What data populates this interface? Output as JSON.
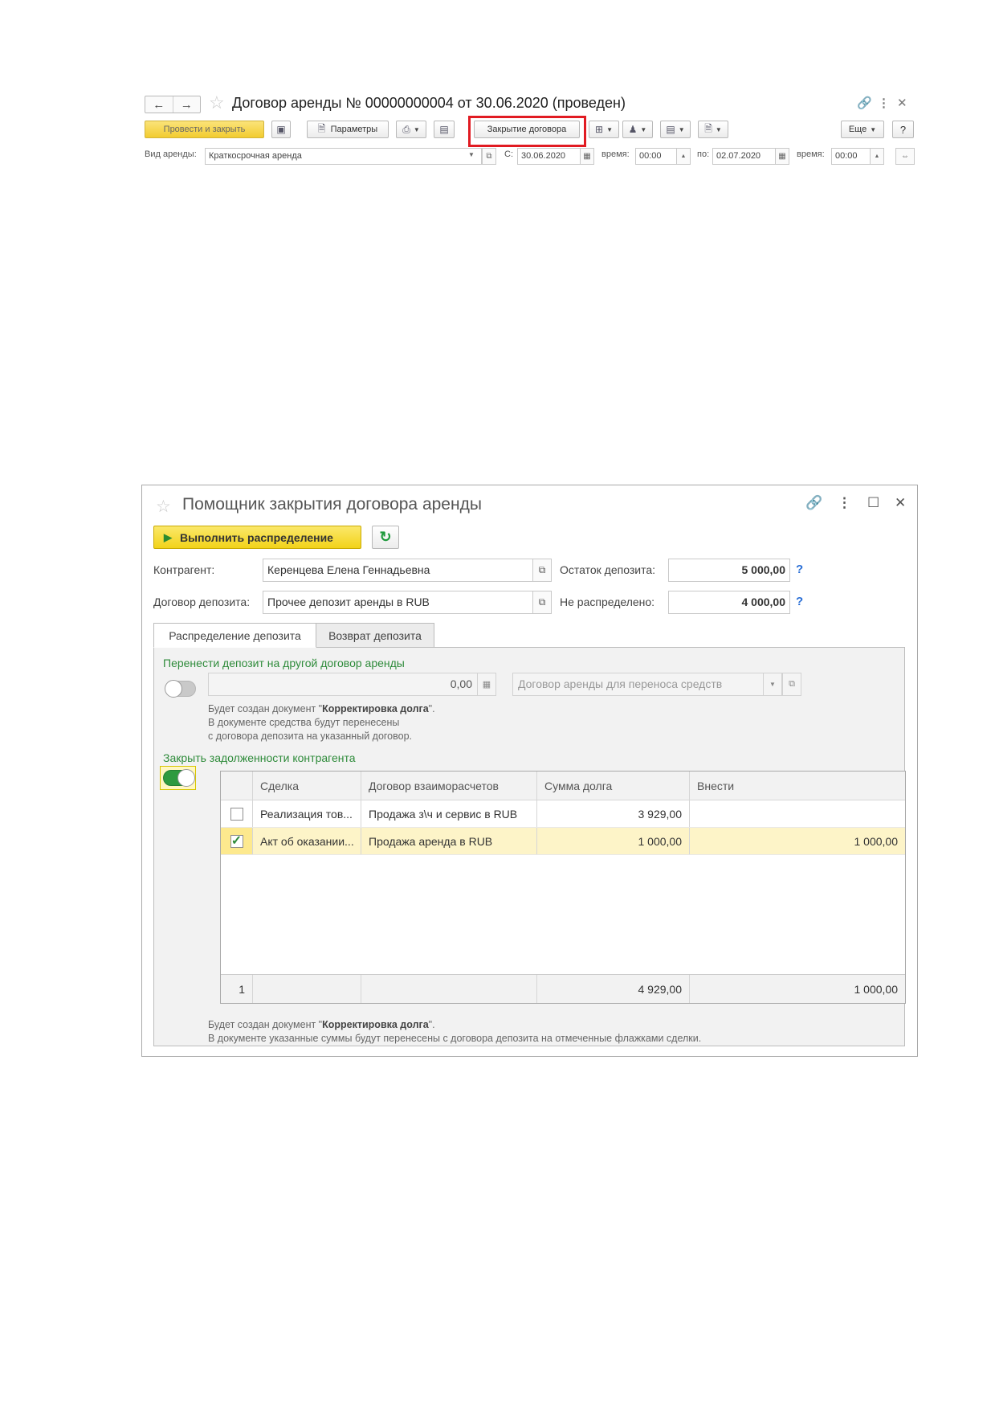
{
  "document": {
    "title": "Договор аренды № 00000000004 от 30.06.2020 (проведен)",
    "toolbar": {
      "post_and_close": "Провести и закрыть",
      "parameters": "Параметры",
      "close_contract": "Закрытие договора",
      "more": "Еще",
      "help": "?"
    },
    "fields": {
      "rent_type_label": "Вид аренды:",
      "rent_type_value": "Краткосрочная аренда",
      "from_label": "С:",
      "from_date": "30.06.2020",
      "time_label_1": "время:",
      "time_value_1": "00:00",
      "to_label": "по:",
      "to_date": "02.07.2020",
      "time_label_2": "время:",
      "time_value_2": "00:00"
    }
  },
  "wizard": {
    "title": "Помощник закрытия договора аренды",
    "run_button": "Выполнить распределение",
    "counterparty_label": "Контрагент:",
    "counterparty_value": "Керенцева Елена Геннадьевна",
    "deposit_contract_label": "Договор депозита:",
    "deposit_contract_value": "Прочее депозит аренды в RUB",
    "deposit_balance_label": "Остаток депозита:",
    "deposit_balance_value": "5 000,00",
    "unallocated_label": "Не распределено:",
    "unallocated_value": "4 000,00",
    "help_mark": "?",
    "tabs": [
      {
        "label": "Распределение депозита",
        "active": true
      },
      {
        "label": "Возврат депозита",
        "active": false
      }
    ],
    "transfer": {
      "label": "Перенести депозит на другой договор аренды",
      "toggle_on": false,
      "amount": "0,00",
      "contract_placeholder": "Договор аренды для переноса средств",
      "note_line1_prefix": "Будет создан документ \"",
      "note_line1_bold": "Корректировка долга",
      "note_line1_suffix": "\".",
      "note_line2": "В документе средства будут перенесены",
      "note_line3": "с договора депозита на указанный договор."
    },
    "debts": {
      "label": "Закрыть задолженности контрагента",
      "toggle_on": true,
      "columns": [
        "Сделка",
        "Договор взаиморасчетов",
        "Сумма долга",
        "Внести"
      ],
      "rows": [
        {
          "checked": false,
          "deal": "Реализация тов...",
          "contract": "Продажа з\\ч и сервис в RUB",
          "debt": "3 929,00",
          "pay": ""
        },
        {
          "checked": true,
          "deal": "Акт об оказании...",
          "contract": "Продажа аренда в RUB",
          "debt": "1 000,00",
          "pay": "1 000,00"
        }
      ],
      "footer": {
        "count": "1",
        "debt_total": "4 929,00",
        "pay_total": "1 000,00"
      },
      "note_line1_prefix": "Будет создан документ \"",
      "note_line1_bold": "Корректировка долга",
      "note_line1_suffix": "\".",
      "note_line2": "В документе указанные суммы будут перенесены с договора депозита на отмеченные флажками сделки."
    }
  },
  "colors": {
    "accent_yellow": "#f2d319",
    "highlight_red": "#e11b22",
    "green_label": "#2e8b3a",
    "link_blue": "#2a6fd6",
    "selected_row": "#fdf4c8"
  },
  "icons": [
    "back-arrow-icon",
    "forward-arrow-icon",
    "star-icon",
    "link-icon",
    "more-vert-icon",
    "close-icon",
    "maximize-icon",
    "refresh-icon",
    "play-icon",
    "calendar-icon",
    "open-icon",
    "dropdown-icon",
    "check-icon"
  ]
}
